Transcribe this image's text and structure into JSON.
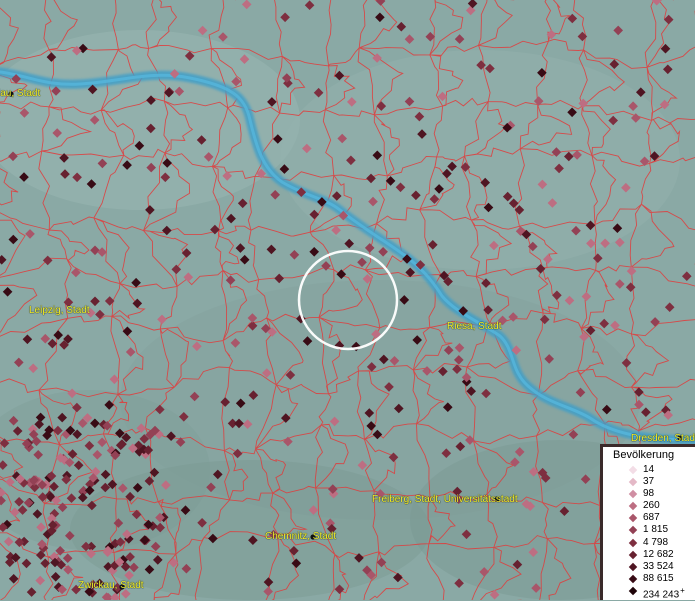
{
  "map": {
    "colors": {
      "background": "#8aa9a5",
      "boundary": "#e23a3a",
      "river": "#3f9fc8",
      "label": "#f2ee2a",
      "focus_circle": "#ffffff"
    },
    "cities": [
      {
        "name": "lau, Stadt"
      },
      {
        "name": "Leipzig, Stadt"
      },
      {
        "name": "Riesa, Stadt"
      },
      {
        "name": "Dresden, Stadt"
      },
      {
        "name": "Freiberg, Stadt, Universitätsstadt"
      },
      {
        "name": "Chemnitz, Stadt"
      },
      {
        "name": "Zwickau, Stadt"
      }
    ]
  },
  "legend": {
    "title": "Bevölkerung",
    "items": [
      {
        "label": "14",
        "color": "#f3dde6"
      },
      {
        "label": "37",
        "color": "#e4b9c7"
      },
      {
        "label": "98",
        "color": "#d08fa3"
      },
      {
        "label": "260",
        "color": "#bd6e82"
      },
      {
        "label": "687",
        "color": "#a9566a"
      },
      {
        "label": "1 815",
        "color": "#934155"
      },
      {
        "label": "4 798",
        "color": "#7e2f40"
      },
      {
        "label": "12 682",
        "color": "#672130"
      },
      {
        "label": "33 524",
        "color": "#4f1522"
      },
      {
        "label": "88 615",
        "color": "#380b15"
      },
      {
        "label": "234 243",
        "color": "#1f0409",
        "plus": "+"
      }
    ]
  }
}
